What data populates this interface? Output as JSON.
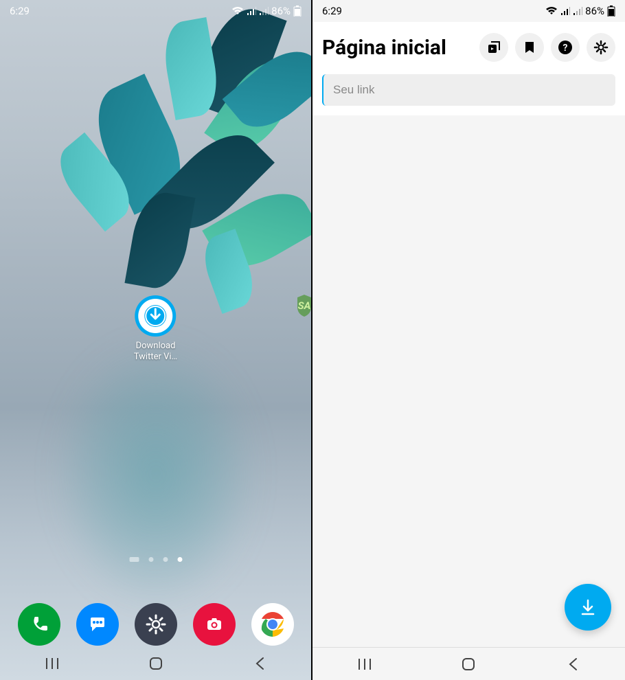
{
  "status": {
    "time": "6:29",
    "battery_pct": "86%",
    "wifi": "wifi-icon",
    "signal1": "signal-icon",
    "signal2": "signal-icon"
  },
  "home": {
    "app_label_line1": "Download",
    "app_label_line2": "Twitter Vi…",
    "dock": {
      "phone": "phone-icon",
      "messages": "messages-icon",
      "settings": "settings-icon",
      "camera": "camera-icon",
      "chrome": "chrome-icon"
    },
    "nav": {
      "recents": "recents-icon",
      "home": "home-icon",
      "back": "back-icon"
    }
  },
  "app": {
    "title": "Página inicial",
    "input_placeholder": "Seu link",
    "header_buttons": {
      "library": "video-library-icon",
      "bookmark": "bookmark-icon",
      "help": "help-icon",
      "settings": "gear-icon"
    },
    "fab": "download-icon"
  }
}
